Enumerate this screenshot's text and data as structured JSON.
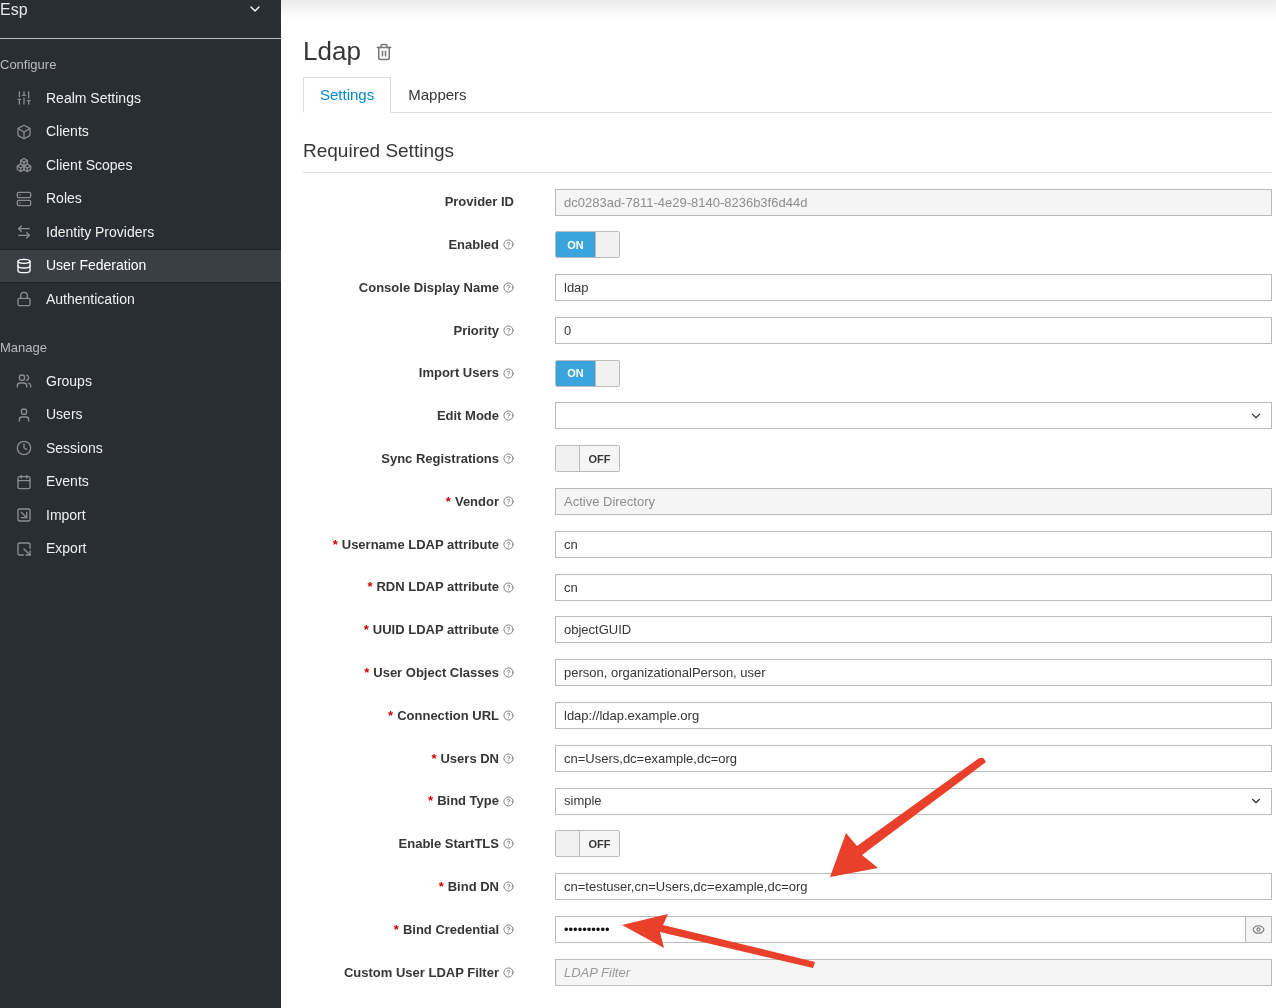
{
  "realm_selector": {
    "label": "Esp"
  },
  "sidebar": {
    "sections": [
      {
        "title": "Configure",
        "items": [
          {
            "label": "Realm Settings",
            "selected": false
          },
          {
            "label": "Clients",
            "selected": false
          },
          {
            "label": "Client Scopes",
            "selected": false
          },
          {
            "label": "Roles",
            "selected": false
          },
          {
            "label": "Identity Providers",
            "selected": false
          },
          {
            "label": "User Federation",
            "selected": true
          },
          {
            "label": "Authentication",
            "selected": false
          }
        ]
      },
      {
        "title": "Manage",
        "items": [
          {
            "label": "Groups",
            "selected": false
          },
          {
            "label": "Users",
            "selected": false
          },
          {
            "label": "Sessions",
            "selected": false
          },
          {
            "label": "Events",
            "selected": false
          },
          {
            "label": "Import",
            "selected": false
          },
          {
            "label": "Export",
            "selected": false
          }
        ]
      }
    ]
  },
  "page": {
    "title": "Ldap",
    "tabs": [
      {
        "label": "Settings",
        "selected": true
      },
      {
        "label": "Mappers",
        "selected": false
      }
    ],
    "section_title": "Required Settings",
    "fields": [
      {
        "label": "Provider ID",
        "help": false,
        "kind": "text",
        "value": "dc0283ad-7811-4e29-8140-8236b3f6d44d",
        "disabled": true
      },
      {
        "label": "Enabled",
        "help": true,
        "kind": "toggle",
        "on": true,
        "text": "ON"
      },
      {
        "label": "Console Display Name",
        "help": true,
        "kind": "text",
        "value": "ldap",
        "disabled": false
      },
      {
        "label": "Priority",
        "help": true,
        "kind": "text",
        "value": "0",
        "disabled": false
      },
      {
        "label": "Import Users",
        "help": true,
        "kind": "toggle",
        "on": true,
        "text": "ON"
      },
      {
        "label": "Edit Mode",
        "help": true,
        "kind": "select"
      },
      {
        "label": "Sync Registrations",
        "help": true,
        "kind": "toggle",
        "on": false,
        "text": "OFF"
      },
      {
        "label": "Vendor",
        "required_marker": "*",
        "help": true,
        "kind": "text",
        "value": "Active Directory",
        "disabled": true
      },
      {
        "label": "Username LDAP attribute",
        "required_marker": "*",
        "help": true,
        "kind": "text",
        "value": "cn",
        "disabled": false
      },
      {
        "label": "RDN LDAP attribute",
        "required_marker": "*",
        "help": true,
        "kind": "text",
        "value": "cn",
        "disabled": false
      },
      {
        "label": "UUID LDAP attribute",
        "required_marker": "*",
        "help": true,
        "kind": "text",
        "value": "objectGUID",
        "disabled": false
      },
      {
        "label": "User Object Classes",
        "required_marker": "*",
        "help": true,
        "kind": "text",
        "value": "person, organizationalPerson, user",
        "disabled": false
      },
      {
        "label": "Connection URL",
        "required_marker": "*",
        "help": true,
        "kind": "text",
        "value": "ldap://ldap.example.org",
        "disabled": false
      },
      {
        "label": "Users DN",
        "required_marker": "*",
        "help": true,
        "kind": "text",
        "value": "cn=Users,dc=example,dc=org",
        "disabled": false
      },
      {
        "label": "Bind Type",
        "required_marker": "*",
        "help": true,
        "kind": "select",
        "value": "simple"
      },
      {
        "label": "Enable StartTLS",
        "help": true,
        "kind": "toggle",
        "on": false,
        "text": "OFF"
      },
      {
        "label": "Bind DN",
        "required_marker": "*",
        "help": true,
        "kind": "text",
        "value": "cn=testuser,cn=Users,dc=example,dc=org",
        "disabled": false
      },
      {
        "label": "Bind Credential",
        "required_marker": "*",
        "help": true,
        "kind": "password",
        "value": "••••••••••"
      },
      {
        "label": "Custom User LDAP Filter",
        "help": true,
        "kind": "text",
        "placeholder": "LDAP Filter",
        "disabled": true
      }
    ]
  }
}
